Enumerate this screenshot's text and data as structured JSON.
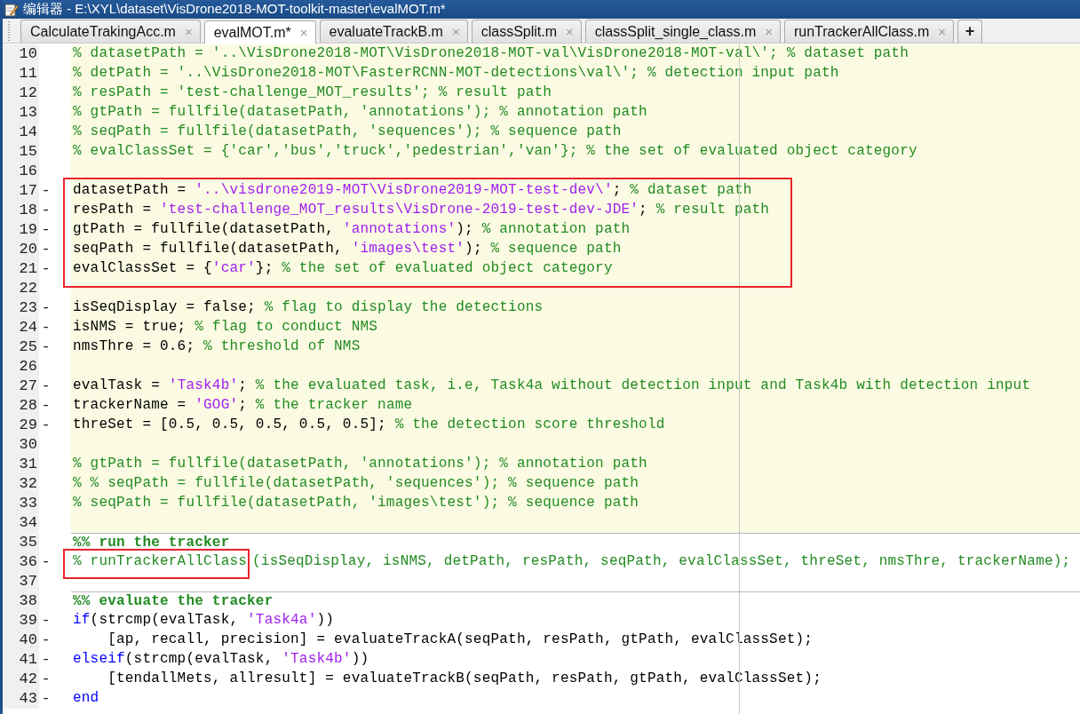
{
  "window": {
    "title": "编辑器 - E:\\XYL\\dataset\\VisDrone2018-MOT-toolkit-master\\evalMOT.m*"
  },
  "tabs": [
    {
      "label": "CalculateTrakingAcc.m",
      "selected": false,
      "close": "×"
    },
    {
      "label": "evalMOT.m*",
      "selected": true,
      "close": "×"
    },
    {
      "label": "evaluateTrackB.m",
      "selected": false,
      "close": "×"
    },
    {
      "label": "classSplit.m",
      "selected": false,
      "close": "×"
    },
    {
      "label": "classSplit_single_class.m",
      "selected": false,
      "close": "×"
    },
    {
      "label": "runTrackerAllClass.m",
      "selected": false,
      "close": "×"
    }
  ],
  "new_tab": "+",
  "lines": [
    {
      "number": "10",
      "current_cell": true,
      "tokens": [
        {
          "kind": "comment",
          "text": "% datasetPath = '..\\VisDrone2018-MOT\\VisDrone2018-MOT-val\\VisDrone2018-MOT-val\\'; % dataset path"
        }
      ]
    },
    {
      "number": "11",
      "current_cell": true,
      "tokens": [
        {
          "kind": "comment",
          "text": "% detPath = '..\\VisDrone2018-MOT\\FasterRCNN-MOT-detections\\val\\'; % detection input path"
        }
      ]
    },
    {
      "number": "12",
      "current_cell": true,
      "tokens": [
        {
          "kind": "comment",
          "text": "% resPath = 'test-challenge_MOT_results'; % result path"
        }
      ]
    },
    {
      "number": "13",
      "current_cell": true,
      "tokens": [
        {
          "kind": "comment",
          "text": "% gtPath = fullfile(datasetPath, 'annotations'); % annotation path"
        }
      ]
    },
    {
      "number": "14",
      "current_cell": true,
      "tokens": [
        {
          "kind": "comment",
          "text": "% seqPath = fullfile(datasetPath, 'sequences'); % sequence path"
        }
      ]
    },
    {
      "number": "15",
      "current_cell": true,
      "tokens": [
        {
          "kind": "comment",
          "text": "% evalClassSet = {'car','bus','truck','pedestrian','van'}; % the set of evaluated object category"
        }
      ]
    },
    {
      "number": "16",
      "current_cell": true
    },
    {
      "number": "17",
      "current_cell": true,
      "marker": "-",
      "boxed": true,
      "tokens": [
        {
          "kind": "code",
          "text": "datasetPath = "
        },
        {
          "kind": "string",
          "text": "'..\\visdrone2019-MOT\\VisDrone2019-MOT-test-dev\\'"
        },
        {
          "kind": "code",
          "text": "; "
        },
        {
          "kind": "comment",
          "text": "% dataset path"
        }
      ]
    },
    {
      "number": "18",
      "current_cell": true,
      "marker": "-",
      "boxed": true,
      "tokens": [
        {
          "kind": "code",
          "text": "resPath = "
        },
        {
          "kind": "string",
          "text": "'test-challenge_MOT_results\\VisDrone-2019-test-dev-JDE'"
        },
        {
          "kind": "code",
          "text": "; "
        },
        {
          "kind": "comment",
          "text": "% result path"
        }
      ]
    },
    {
      "number": "19",
      "current_cell": true,
      "marker": "-",
      "boxed": true,
      "tokens": [
        {
          "kind": "code",
          "text": "gtPath = fullfile(datasetPath, "
        },
        {
          "kind": "string",
          "text": "'annotations'"
        },
        {
          "kind": "code",
          "text": "); "
        },
        {
          "kind": "comment",
          "text": "% annotation path"
        }
      ]
    },
    {
      "number": "20",
      "current_cell": true,
      "marker": "-",
      "boxed": true,
      "tokens": [
        {
          "kind": "code",
          "text": "seqPath = fullfile(datasetPath, "
        },
        {
          "kind": "string",
          "text": "'images\\test'"
        },
        {
          "kind": "code",
          "text": "); "
        },
        {
          "kind": "comment",
          "text": "% sequence path"
        }
      ]
    },
    {
      "number": "21",
      "current_cell": true,
      "marker": "-",
      "boxed": true,
      "tokens": [
        {
          "kind": "code",
          "text": "evalClassSet = {"
        },
        {
          "kind": "string",
          "text": "'car'"
        },
        {
          "kind": "code",
          "text": "}; "
        },
        {
          "kind": "comment",
          "text": "% the set of evaluated object category"
        }
      ]
    },
    {
      "number": "22",
      "current_cell": true
    },
    {
      "number": "23",
      "current_cell": true,
      "marker": "-",
      "tokens": [
        {
          "kind": "code",
          "text": "isSeqDisplay = false; "
        },
        {
          "kind": "comment",
          "text": "% flag to display the detections"
        }
      ]
    },
    {
      "number": "24",
      "current_cell": true,
      "marker": "-",
      "tokens": [
        {
          "kind": "code",
          "text": "isNMS = true; "
        },
        {
          "kind": "comment",
          "text": "% flag to conduct NMS"
        }
      ]
    },
    {
      "number": "25",
      "current_cell": true,
      "marker": "-",
      "tokens": [
        {
          "kind": "code",
          "text": "nmsThre = 0.6; "
        },
        {
          "kind": "comment",
          "text": "% threshold of NMS"
        }
      ]
    },
    {
      "number": "26",
      "current_cell": true
    },
    {
      "number": "27",
      "current_cell": true,
      "marker": "-",
      "tokens": [
        {
          "kind": "code",
          "text": "evalTask = "
        },
        {
          "kind": "string",
          "text": "'Task4b'"
        },
        {
          "kind": "code",
          "text": "; "
        },
        {
          "kind": "comment",
          "text": "% the evaluated task, i.e, Task4a without detection input and Task4b with detection input"
        }
      ]
    },
    {
      "number": "28",
      "current_cell": true,
      "marker": "-",
      "tokens": [
        {
          "kind": "code",
          "text": "trackerName = "
        },
        {
          "kind": "string",
          "text": "'GOG'"
        },
        {
          "kind": "code",
          "text": "; "
        },
        {
          "kind": "comment",
          "text": "% the tracker name"
        }
      ]
    },
    {
      "number": "29",
      "current_cell": true,
      "marker": "-",
      "tokens": [
        {
          "kind": "code",
          "text": "threSet = [0.5, 0.5, 0.5, 0.5, 0.5]; "
        },
        {
          "kind": "comment",
          "text": "% the detection score threshold"
        }
      ]
    },
    {
      "number": "30",
      "current_cell": true
    },
    {
      "number": "31",
      "current_cell": true,
      "tokens": [
        {
          "kind": "comment",
          "text": "% gtPath = fullfile(datasetPath, 'annotations'); % annotation path"
        }
      ]
    },
    {
      "number": "32",
      "current_cell": true,
      "tokens": [
        {
          "kind": "comment",
          "text": "% % seqPath = fullfile(datasetPath, 'sequences'); % sequence path"
        }
      ]
    },
    {
      "number": "33",
      "current_cell": true,
      "tokens": [
        {
          "kind": "comment",
          "text": "% seqPath = fullfile(datasetPath, 'images\\test'); % sequence path"
        }
      ]
    },
    {
      "number": "34",
      "current_cell": true
    },
    {
      "number": "35",
      "current_cell": false,
      "tokens": [
        {
          "kind": "section",
          "text": "%% run the tracker"
        }
      ]
    },
    {
      "number": "36",
      "current_cell": false,
      "marker": "-",
      "tokens": [
        {
          "kind": "comment",
          "text": "% runTrackerAllClass",
          "boxed": true
        },
        {
          "kind": "comment",
          "text": "(isSeqDisplay, isNMS, detPath, resPath, seqPath, evalClassSet, threSet, nmsThre, trackerName);"
        }
      ]
    },
    {
      "number": "37",
      "current_cell": false
    },
    {
      "number": "38",
      "current_cell": false,
      "tokens": [
        {
          "kind": "section",
          "text": "%% evaluate the tracker"
        }
      ]
    },
    {
      "number": "39",
      "current_cell": false,
      "marker": "-",
      "tokens": [
        {
          "kind": "keyword",
          "text": "if"
        },
        {
          "kind": "code",
          "text": "(strcmp(evalTask, "
        },
        {
          "kind": "string",
          "text": "'Task4a'"
        },
        {
          "kind": "code",
          "text": "))"
        }
      ]
    },
    {
      "number": "40",
      "current_cell": false,
      "marker": "-",
      "tokens": [
        {
          "kind": "code",
          "text": "    [ap, recall, precision] = evaluateTrackA(seqPath, resPath, gtPath, evalClassSet);"
        }
      ]
    },
    {
      "number": "41",
      "current_cell": false,
      "marker": "-",
      "tokens": [
        {
          "kind": "keyword",
          "text": "elseif"
        },
        {
          "kind": "code",
          "text": "(strcmp(evalTask, "
        },
        {
          "kind": "string",
          "text": "'Task4b'"
        },
        {
          "kind": "code",
          "text": "))"
        }
      ]
    },
    {
      "number": "42",
      "current_cell": false,
      "marker": "-",
      "tokens": [
        {
          "kind": "code",
          "text": "    [tendallMets, allresult] = evaluateTrackB(seqPath, resPath, gtPath, evalClassSet);"
        }
      ]
    },
    {
      "number": "43",
      "current_cell": false,
      "marker": "-",
      "tokens": [
        {
          "kind": "keyword",
          "text": "end"
        }
      ]
    }
  ]
}
